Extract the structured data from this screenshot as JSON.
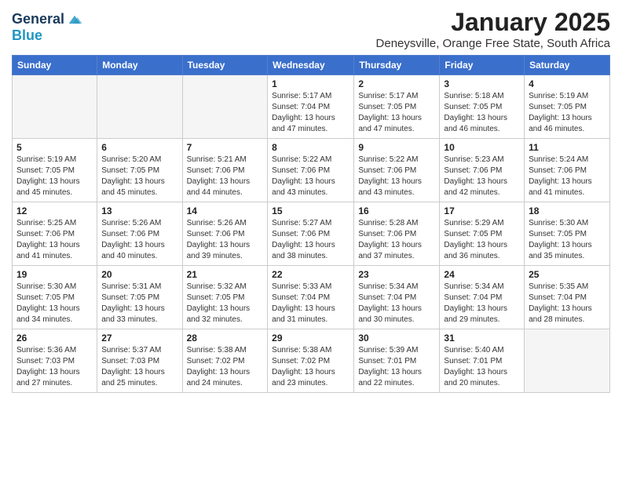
{
  "header": {
    "logo_line1": "General",
    "logo_line2": "Blue",
    "month_title": "January 2025",
    "location": "Deneysville, Orange Free State, South Africa"
  },
  "weekdays": [
    "Sunday",
    "Monday",
    "Tuesday",
    "Wednesday",
    "Thursday",
    "Friday",
    "Saturday"
  ],
  "weeks": [
    [
      {
        "day": "",
        "info": ""
      },
      {
        "day": "",
        "info": ""
      },
      {
        "day": "",
        "info": ""
      },
      {
        "day": "1",
        "info": "Sunrise: 5:17 AM\nSunset: 7:04 PM\nDaylight: 13 hours and 47 minutes."
      },
      {
        "day": "2",
        "info": "Sunrise: 5:17 AM\nSunset: 7:05 PM\nDaylight: 13 hours and 47 minutes."
      },
      {
        "day": "3",
        "info": "Sunrise: 5:18 AM\nSunset: 7:05 PM\nDaylight: 13 hours and 46 minutes."
      },
      {
        "day": "4",
        "info": "Sunrise: 5:19 AM\nSunset: 7:05 PM\nDaylight: 13 hours and 46 minutes."
      }
    ],
    [
      {
        "day": "5",
        "info": "Sunrise: 5:19 AM\nSunset: 7:05 PM\nDaylight: 13 hours and 45 minutes."
      },
      {
        "day": "6",
        "info": "Sunrise: 5:20 AM\nSunset: 7:05 PM\nDaylight: 13 hours and 45 minutes."
      },
      {
        "day": "7",
        "info": "Sunrise: 5:21 AM\nSunset: 7:06 PM\nDaylight: 13 hours and 44 minutes."
      },
      {
        "day": "8",
        "info": "Sunrise: 5:22 AM\nSunset: 7:06 PM\nDaylight: 13 hours and 43 minutes."
      },
      {
        "day": "9",
        "info": "Sunrise: 5:22 AM\nSunset: 7:06 PM\nDaylight: 13 hours and 43 minutes."
      },
      {
        "day": "10",
        "info": "Sunrise: 5:23 AM\nSunset: 7:06 PM\nDaylight: 13 hours and 42 minutes."
      },
      {
        "day": "11",
        "info": "Sunrise: 5:24 AM\nSunset: 7:06 PM\nDaylight: 13 hours and 41 minutes."
      }
    ],
    [
      {
        "day": "12",
        "info": "Sunrise: 5:25 AM\nSunset: 7:06 PM\nDaylight: 13 hours and 41 minutes."
      },
      {
        "day": "13",
        "info": "Sunrise: 5:26 AM\nSunset: 7:06 PM\nDaylight: 13 hours and 40 minutes."
      },
      {
        "day": "14",
        "info": "Sunrise: 5:26 AM\nSunset: 7:06 PM\nDaylight: 13 hours and 39 minutes."
      },
      {
        "day": "15",
        "info": "Sunrise: 5:27 AM\nSunset: 7:06 PM\nDaylight: 13 hours and 38 minutes."
      },
      {
        "day": "16",
        "info": "Sunrise: 5:28 AM\nSunset: 7:06 PM\nDaylight: 13 hours and 37 minutes."
      },
      {
        "day": "17",
        "info": "Sunrise: 5:29 AM\nSunset: 7:05 PM\nDaylight: 13 hours and 36 minutes."
      },
      {
        "day": "18",
        "info": "Sunrise: 5:30 AM\nSunset: 7:05 PM\nDaylight: 13 hours and 35 minutes."
      }
    ],
    [
      {
        "day": "19",
        "info": "Sunrise: 5:30 AM\nSunset: 7:05 PM\nDaylight: 13 hours and 34 minutes."
      },
      {
        "day": "20",
        "info": "Sunrise: 5:31 AM\nSunset: 7:05 PM\nDaylight: 13 hours and 33 minutes."
      },
      {
        "day": "21",
        "info": "Sunrise: 5:32 AM\nSunset: 7:05 PM\nDaylight: 13 hours and 32 minutes."
      },
      {
        "day": "22",
        "info": "Sunrise: 5:33 AM\nSunset: 7:04 PM\nDaylight: 13 hours and 31 minutes."
      },
      {
        "day": "23",
        "info": "Sunrise: 5:34 AM\nSunset: 7:04 PM\nDaylight: 13 hours and 30 minutes."
      },
      {
        "day": "24",
        "info": "Sunrise: 5:34 AM\nSunset: 7:04 PM\nDaylight: 13 hours and 29 minutes."
      },
      {
        "day": "25",
        "info": "Sunrise: 5:35 AM\nSunset: 7:04 PM\nDaylight: 13 hours and 28 minutes."
      }
    ],
    [
      {
        "day": "26",
        "info": "Sunrise: 5:36 AM\nSunset: 7:03 PM\nDaylight: 13 hours and 27 minutes."
      },
      {
        "day": "27",
        "info": "Sunrise: 5:37 AM\nSunset: 7:03 PM\nDaylight: 13 hours and 25 minutes."
      },
      {
        "day": "28",
        "info": "Sunrise: 5:38 AM\nSunset: 7:02 PM\nDaylight: 13 hours and 24 minutes."
      },
      {
        "day": "29",
        "info": "Sunrise: 5:38 AM\nSunset: 7:02 PM\nDaylight: 13 hours and 23 minutes."
      },
      {
        "day": "30",
        "info": "Sunrise: 5:39 AM\nSunset: 7:01 PM\nDaylight: 13 hours and 22 minutes."
      },
      {
        "day": "31",
        "info": "Sunrise: 5:40 AM\nSunset: 7:01 PM\nDaylight: 13 hours and 20 minutes."
      },
      {
        "day": "",
        "info": ""
      }
    ]
  ]
}
